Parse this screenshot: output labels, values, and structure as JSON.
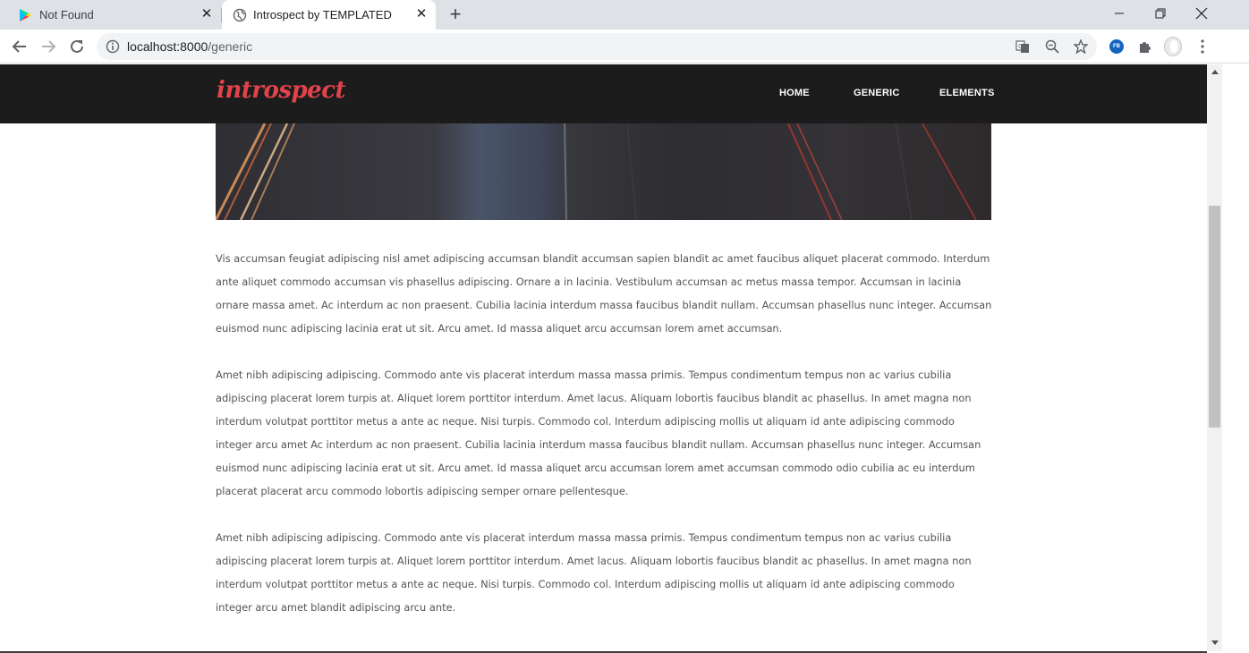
{
  "browser": {
    "tabs": [
      {
        "title": "Not Found",
        "active": false
      },
      {
        "title": "Introspect by TEMPLATED",
        "active": true
      }
    ],
    "address": {
      "host": "localhost:8000",
      "path": "/generic"
    },
    "accent": "#1a73e8"
  },
  "site": {
    "logo": "introspect",
    "logo_color": "#e1434b",
    "header_bg": "#1c1c1c",
    "nav": [
      {
        "label": "HOME"
      },
      {
        "label": "GENERIC"
      },
      {
        "label": "ELEMENTS"
      }
    ]
  },
  "content": {
    "paragraphs": [
      "Vis accumsan feugiat adipiscing nisl amet adipiscing accumsan blandit accumsan sapien blandit ac amet faucibus aliquet placerat commodo. Interdum ante aliquet commodo accumsan vis phasellus adipiscing. Ornare a in lacinia. Vestibulum accumsan ac metus massa tempor. Accumsan in lacinia ornare massa amet. Ac interdum ac non praesent. Cubilia lacinia interdum massa faucibus blandit nullam. Accumsan phasellus nunc integer. Accumsan euismod nunc adipiscing lacinia erat ut sit. Arcu amet. Id massa aliquet arcu accumsan lorem amet accumsan.",
      "Amet nibh adipiscing adipiscing. Commodo ante vis placerat interdum massa massa primis. Tempus condimentum tempus non ac varius cubilia adipiscing placerat lorem turpis at. Aliquet lorem porttitor interdum. Amet lacus. Aliquam lobortis faucibus blandit ac phasellus. In amet magna non interdum volutpat porttitor metus a ante ac neque. Nisi turpis. Commodo col. Interdum adipiscing mollis ut aliquam id ante adipiscing commodo integer arcu amet Ac interdum ac non praesent. Cubilia lacinia interdum massa faucibus blandit nullam. Accumsan phasellus nunc integer. Accumsan euismod nunc adipiscing lacinia erat ut sit. Arcu amet. Id massa aliquet arcu accumsan lorem amet accumsan commodo odio cubilia ac eu interdum placerat placerat arcu commodo lobortis adipiscing semper ornare pellentesque.",
      "Amet nibh adipiscing adipiscing. Commodo ante vis placerat interdum massa massa primis. Tempus condimentum tempus non ac varius cubilia adipiscing placerat lorem turpis at. Aliquet lorem porttitor interdum. Amet lacus. Aliquam lobortis faucibus blandit ac phasellus. In amet magna non interdum volutpat porttitor metus a ante ac neque. Nisi turpis. Commodo col. Interdum adipiscing mollis ut aliquam id ante adipiscing commodo integer arcu amet blandit adipiscing arcu ante."
    ]
  },
  "icons": {
    "tab1": "google-play-icon",
    "tab2": "globe-icon",
    "translate": "translate-icon",
    "zoom": "zoom-icon",
    "bookmark": "star-icon",
    "extension": "puzzle-icon",
    "profile": "avatar-icon",
    "menu": "kebab-menu-icon"
  },
  "extension_badge": "FB"
}
